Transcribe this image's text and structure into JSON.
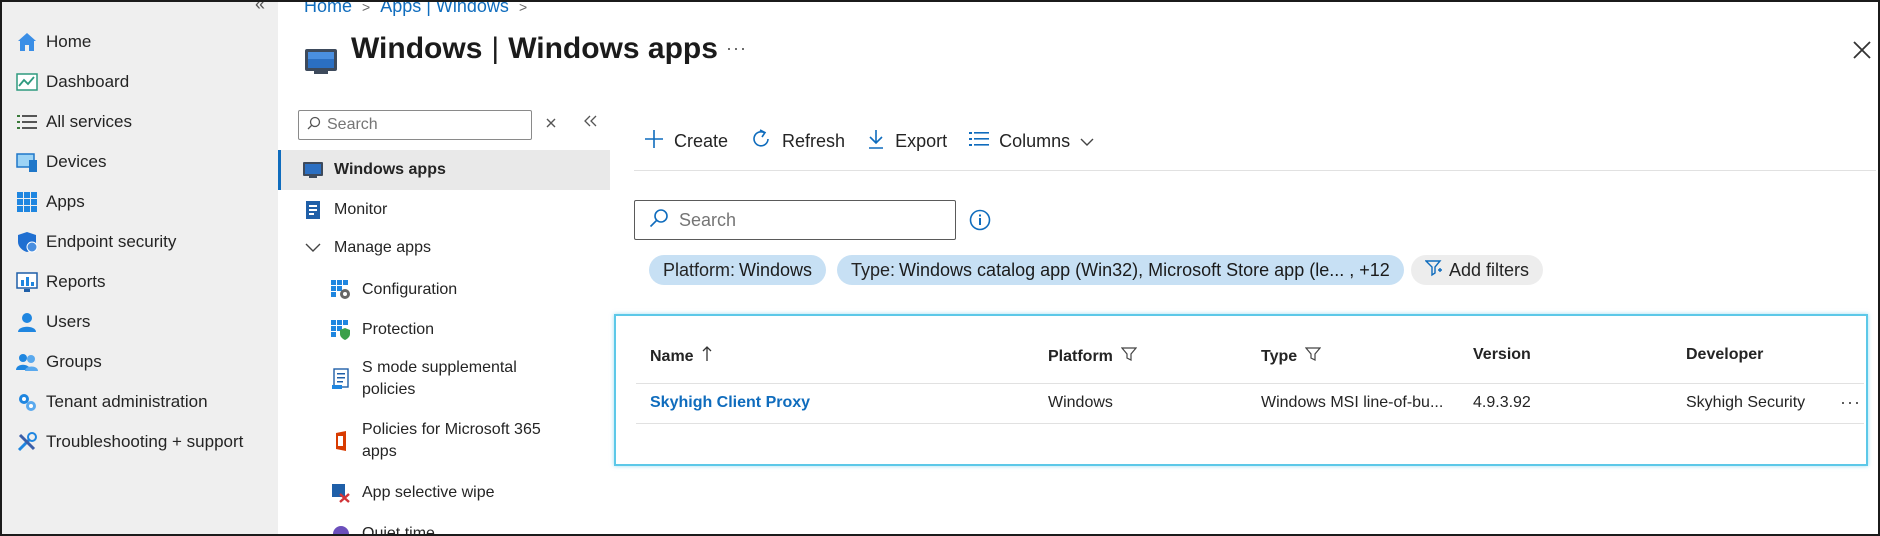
{
  "global_nav": {
    "collapse_glyph": "«",
    "items": [
      {
        "label": "Home",
        "icon": "home-icon"
      },
      {
        "label": "Dashboard",
        "icon": "dashboard-icon"
      },
      {
        "label": "All services",
        "icon": "list-icon"
      },
      {
        "label": "Devices",
        "icon": "devices-icon"
      },
      {
        "label": "Apps",
        "icon": "apps-grid-icon"
      },
      {
        "label": "Endpoint security",
        "icon": "shield-icon"
      },
      {
        "label": "Reports",
        "icon": "reports-icon"
      },
      {
        "label": "Users",
        "icon": "user-icon"
      },
      {
        "label": "Groups",
        "icon": "groups-icon"
      },
      {
        "label": "Tenant administration",
        "icon": "tenant-admin-icon"
      },
      {
        "label": "Troubleshooting + support",
        "icon": "tools-icon"
      }
    ]
  },
  "breadcrumb": {
    "items": [
      "Home",
      "Apps | Windows"
    ],
    "separator": ">"
  },
  "page": {
    "title_bold": "Windows",
    "title_sep": "|",
    "title_rest": "Windows apps",
    "more": "···"
  },
  "inner_menu": {
    "search_placeholder": "Search",
    "items": [
      {
        "label": "Windows apps",
        "icon": "windows-apps-icon",
        "active": true
      },
      {
        "label": "Monitor",
        "icon": "monitor-icon"
      },
      {
        "label": "Manage apps",
        "icon": "chevron-down-icon"
      },
      {
        "label": "Configuration",
        "icon": "configuration-icon"
      },
      {
        "label": "Protection",
        "icon": "protection-icon"
      },
      {
        "label": "S mode supplemental policies",
        "icon": "policy-doc-icon"
      },
      {
        "label": "Policies for Microsoft 365 apps",
        "icon": "office-icon"
      },
      {
        "label": "App selective wipe",
        "icon": "wipe-icon"
      },
      {
        "label": "Quiet time",
        "icon": "quiet-time-icon"
      }
    ]
  },
  "toolbar": {
    "create": "Create",
    "refresh": "Refresh",
    "export": "Export",
    "columns": "Columns"
  },
  "search": {
    "placeholder": "Search"
  },
  "filters": [
    {
      "key": "Platform:",
      "value": "Windows"
    },
    {
      "key": "Type:",
      "value": "Windows catalog app (Win32), Microsoft Store app (le... , +12"
    }
  ],
  "add_filters": "Add filters",
  "table": {
    "columns": [
      "Name",
      "Platform",
      "Type",
      "Version",
      "Developer"
    ],
    "rows": [
      {
        "name": "Skyhigh Client Proxy",
        "platform": "Windows",
        "type": "Windows MSI line-of-bu...",
        "version": "4.9.3.92",
        "developer": "Skyhigh Security"
      }
    ],
    "row_more": "···"
  },
  "colors": {
    "accent": "#0f6cbd",
    "pill": "#c7e0f4",
    "nav_bg": "#efefef",
    "grid_highlight": "#5cc8e8"
  }
}
